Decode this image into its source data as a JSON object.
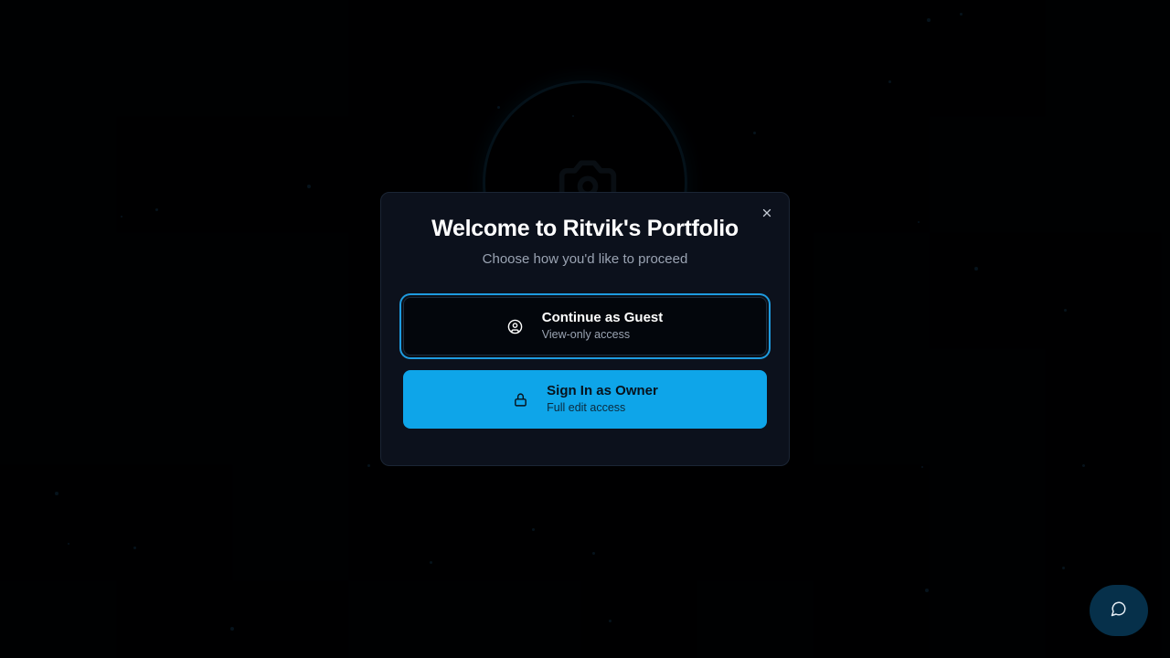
{
  "modal": {
    "title": "Welcome to Ritvik's Portfolio",
    "subtitle": "Choose how you'd like to proceed",
    "close_icon": "close-icon",
    "options": [
      {
        "label": "Continue as Guest",
        "sublabel": "View-only access",
        "icon": "user-circle-icon"
      },
      {
        "label": "Sign In as Owner",
        "sublabel": "Full edit access",
        "icon": "lock-icon"
      }
    ]
  },
  "background": {
    "avatar_icon": "camera-icon"
  },
  "chat_button": {
    "icon": "message-circle-icon"
  },
  "colors": {
    "accent": "#0ea5e9",
    "modal_bg": "#0c111c",
    "page_bg": "#000000",
    "focus_ring": "#1e9be0"
  }
}
